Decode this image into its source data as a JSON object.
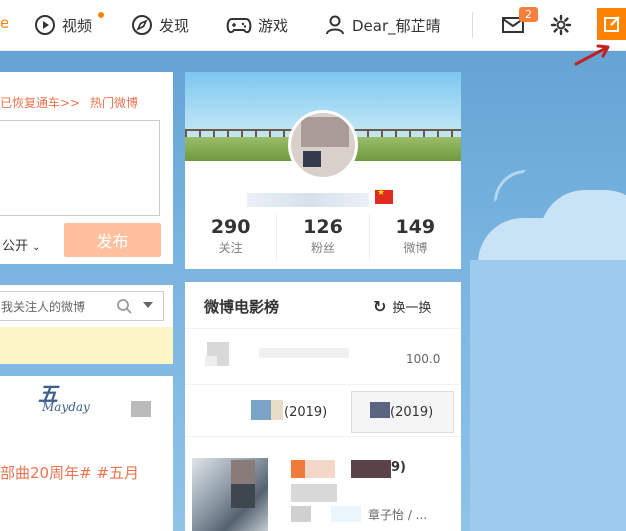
{
  "topbar": {
    "left_cut_text": "e",
    "nav": [
      {
        "label": "视频",
        "icon": "video-play-icon",
        "has_dot": true
      },
      {
        "label": "发现",
        "icon": "compass-icon",
        "has_dot": false
      },
      {
        "label": "游戏",
        "icon": "gamepad-icon",
        "has_dot": false
      },
      {
        "label": "Dear_郁芷晴",
        "icon": "user-icon",
        "has_dot": false
      }
    ],
    "message_count": "2",
    "colors": {
      "accent": "#ff8200",
      "badge": "#f5803e"
    }
  },
  "composer": {
    "links": [
      "已恢复通车>>",
      "热门微博"
    ],
    "privacy": "公开",
    "publish": "发布"
  },
  "search": {
    "placeholder": "我关注人的微博"
  },
  "feed": {
    "logo_text": "五",
    "logo_subtext": "Mayday",
    "topic_line": "部曲20周年# #五月"
  },
  "profile": {
    "stats": [
      {
        "num": "290",
        "label": "关注"
      },
      {
        "num": "126",
        "label": "粉丝"
      },
      {
        "num": "149",
        "label": "微博"
      }
    ]
  },
  "movies": {
    "title": "微博电影榜",
    "refresh": "换一换",
    "row1_score": "100.0",
    "row2_left": "(2019)",
    "row2_right": "(2019)",
    "row3_tag": "9)",
    "row3_cast": "章子怡 / ..."
  }
}
